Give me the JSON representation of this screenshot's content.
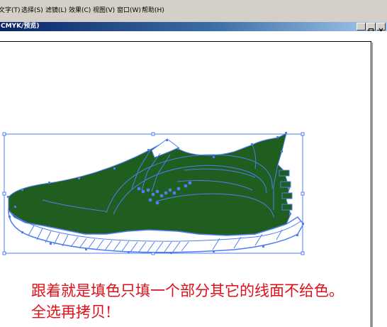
{
  "menu": {
    "items": [
      {
        "label": "文字(T)"
      },
      {
        "label": "选择(S)"
      },
      {
        "label": "滤镜(L)"
      },
      {
        "label": "效果(C)"
      },
      {
        "label": "视图(V)"
      },
      {
        "label": "窗口(W)"
      },
      {
        "label": "帮助(H)"
      }
    ]
  },
  "document": {
    "title": "CMYK/预览)"
  },
  "caption": {
    "line1": "跟着就是填色只填一个部分其它的线面不给色。",
    "line2": "全选再拷贝!"
  },
  "colors": {
    "shoe_fill": "#1f5e1e",
    "path_stroke": "#4f7df2",
    "caption": "#e0101a"
  }
}
